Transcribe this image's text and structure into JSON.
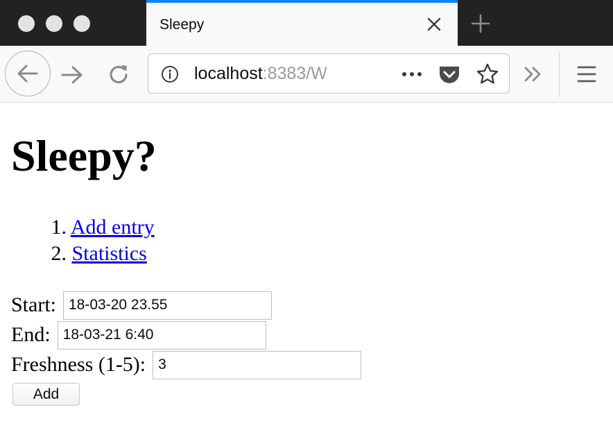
{
  "browser": {
    "tab": {
      "title": "Sleepy",
      "close_icon": "close-icon"
    },
    "new_tab_icon": "plus-icon",
    "url": {
      "host": "localhost",
      "rest": ":8383/W"
    },
    "icons": [
      "back-arrow-icon",
      "forward-arrow-icon",
      "reload-icon",
      "info-icon",
      "more-dots-icon",
      "pocket-icon",
      "star-icon",
      "overflow-chevron-icon",
      "hamburger-menu-icon"
    ],
    "colors": {
      "tab_accent": "#0a84ff",
      "titlebar": "#222223",
      "toolbar": "#f9f9fa"
    }
  },
  "page": {
    "title": "Sleepy?",
    "nav": [
      {
        "number": "1.",
        "label": "Add entry"
      },
      {
        "number": "2.",
        "label": "Statistics"
      }
    ],
    "form": {
      "start": {
        "label": "Start:",
        "value": "18-03-20 23.55"
      },
      "end": {
        "label": "End:",
        "value": "18-03-21 6:40"
      },
      "freshness": {
        "label": "Freshness (1-5):",
        "value": "3"
      },
      "submit_label": "Add"
    },
    "colors": {
      "link": "#0000ee"
    }
  }
}
